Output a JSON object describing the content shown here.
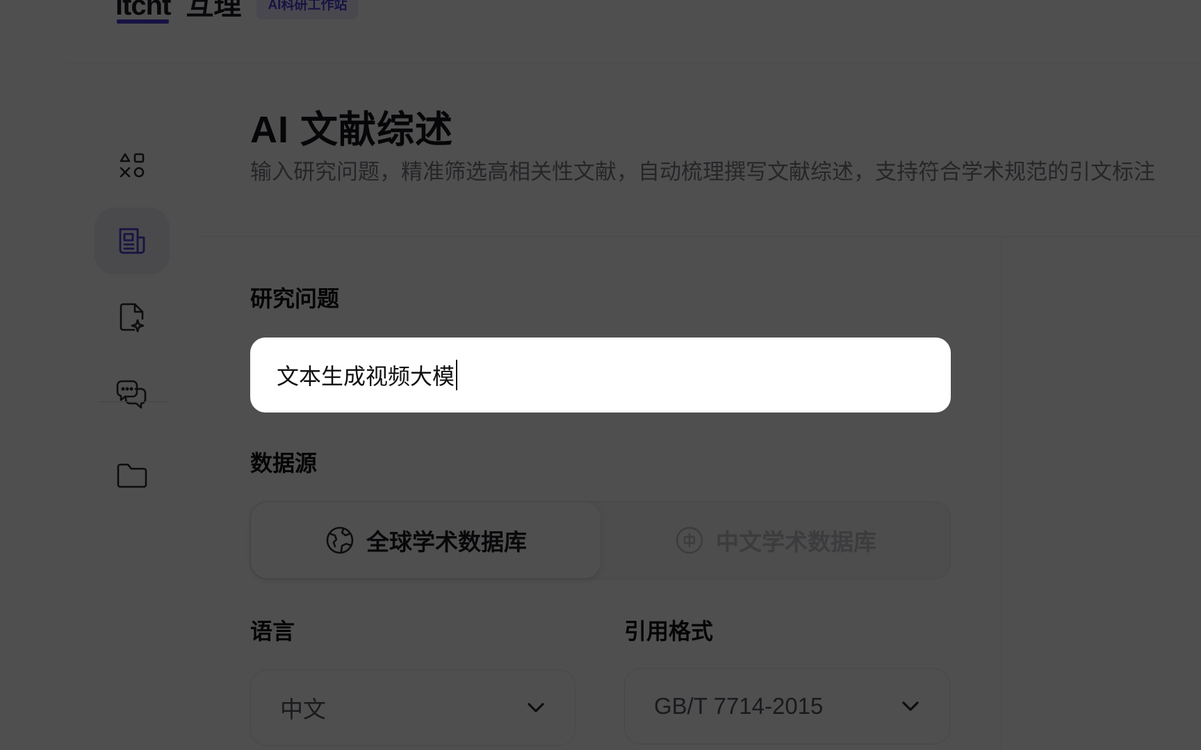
{
  "brand": {
    "logo_en": "itcht",
    "logo_cn": "互理",
    "badge": "AI科研工作站"
  },
  "sidebar": {
    "items": [
      {
        "name": "apps-icon",
        "active": false
      },
      {
        "name": "article-icon",
        "active": true
      },
      {
        "name": "file-spark-icon",
        "active": false
      },
      {
        "name": "chat-icon",
        "active": false
      },
      {
        "name": "folder-icon",
        "active": false
      }
    ]
  },
  "page": {
    "title": "AI 文献综述",
    "description": "输入研究问题，精准筛选高相关性文献，自动梳理撰写文献综述，支持符合学术规范的引文标注"
  },
  "form": {
    "question_label": "研究问题",
    "question_value": "文本生成视频大模",
    "source_label": "数据源",
    "sources": [
      {
        "label": "全球学术数据库",
        "icon": "globe-icon",
        "selected": true
      },
      {
        "label": "中文学术数据库",
        "icon": "zh-badge-icon",
        "selected": false
      }
    ],
    "language_label": "语言",
    "language_value": "中文",
    "citation_label": "引用格式",
    "citation_value": "GB/T 7714-2015"
  },
  "colors": {
    "accent": "#4b3fd6",
    "overlay": "rgba(0,0,0,0.69)"
  }
}
